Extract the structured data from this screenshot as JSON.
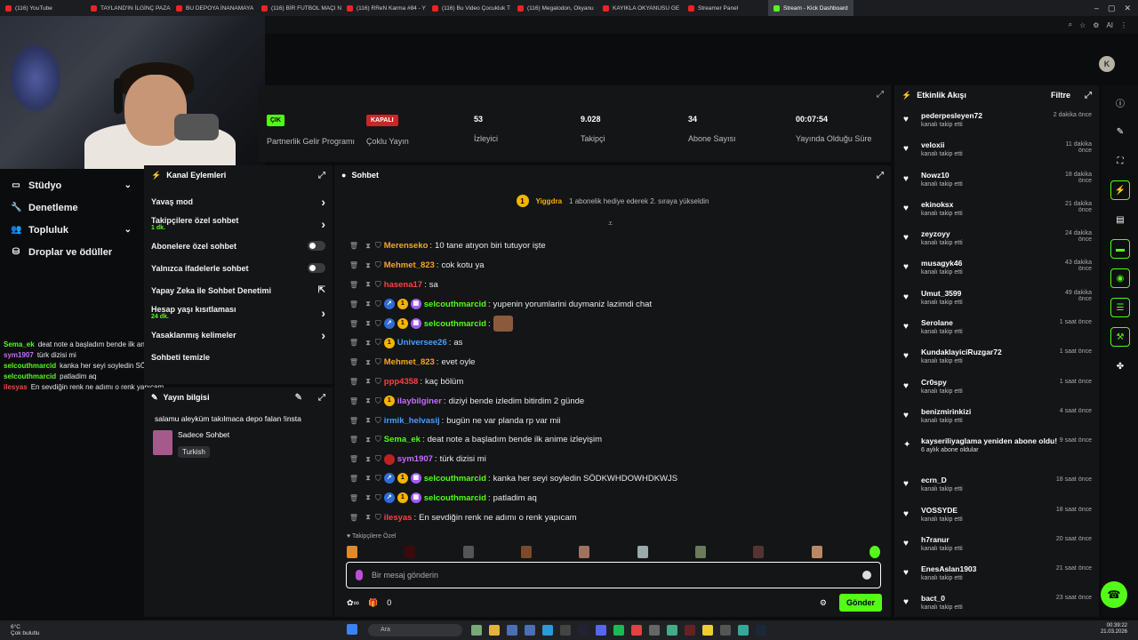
{
  "browser": {
    "tabs": [
      "(116) YouTube",
      "TAYLAND'IN İLGİNÇ PAZA",
      "BU DEPOYA İNANAMAYA",
      "(116) BİR FUTBOL MAÇI N",
      "(116) RReN Karma #84 - Y",
      "(116) Bu Video Çocukluk T",
      "(116) Megalodon, Okyanu",
      "KAYIKLA OKYANUSU GE",
      "Streamer Panel",
      "Stream - Kick Dashboard"
    ],
    "extension_ai": "AI"
  },
  "left_nav": [
    {
      "label": "Stüdyo",
      "icon": "monitor-icon",
      "chevron": true
    },
    {
      "label": "Denetleme",
      "icon": "wrench-icon",
      "chevron": false
    },
    {
      "label": "Topluluk",
      "icon": "people-icon",
      "chevron": true
    },
    {
      "label": "Droplar ve ödüller",
      "icon": "gift-icon",
      "chevron": false
    }
  ],
  "overlay_chat": [
    {
      "user": "Sema_ek",
      "color": "#53fc18",
      "text": "deat note a başladım bende ilk anime izleyişim"
    },
    {
      "user": "sym1907",
      "color": "#c86bff",
      "text": "türk dizisi mi"
    },
    {
      "user": "selcouthmarcid",
      "color": "#53fc18",
      "text": "kanka her seyi soyledin SÖDKWHDOWHDKWJS"
    },
    {
      "user": "selcouthmarcid",
      "color": "#53fc18",
      "text": "patladim aq"
    },
    {
      "user": "ilesyas",
      "color": "#ff4040",
      "text": "En sevdiğin renk ne adımı o renk yapıcam"
    }
  ],
  "stats": [
    {
      "value": "ÇIK",
      "label": "Partnerlik Gelir Programı",
      "kind": "green"
    },
    {
      "value": "KAPALI",
      "label": "Çoklu Yayın",
      "kind": "red"
    },
    {
      "value": "53",
      "label": "İzleyici",
      "kind": "text"
    },
    {
      "value": "9.028",
      "label": "Takipçi",
      "kind": "text"
    },
    {
      "value": "34",
      "label": "Abone Sayısı",
      "kind": "text"
    },
    {
      "value": "00:07:54",
      "label": "Yayında Olduğu Süre",
      "kind": "text"
    }
  ],
  "kanal": {
    "title": "Kanal Eylemleri",
    "rows": [
      {
        "label": "Yavaş mod",
        "sub": "",
        "control": "chevron"
      },
      {
        "label": "Takipçilere özel sohbet",
        "sub": "1 dk.",
        "control": "chevron"
      },
      {
        "label": "Abonelere özel sohbet",
        "sub": "",
        "control": "toggle"
      },
      {
        "label": "Yalnızca ifadelerle sohbet",
        "sub": "",
        "control": "toggle"
      },
      {
        "label": "Yapay Zeka ile Sohbet Denetimi",
        "sub": "",
        "control": "external"
      },
      {
        "label": "Hesap yaşı kısıtlaması",
        "sub": "24 dk.",
        "control": "chevron"
      },
      {
        "label": "Yasaklanmış kelimeler",
        "sub": "",
        "control": "chevron"
      },
      {
        "label": "Sohbeti temizle",
        "sub": "",
        "control": "none"
      }
    ]
  },
  "yayin": {
    "title": "Yayın bilgisi",
    "stream_title": "salamu aleyküm takılmaca depo falan !insta",
    "category": "Sadece Sohbet",
    "language": "Turkish"
  },
  "chat": {
    "title": "Sohbet",
    "pinned_user": "Yiggdra",
    "pinned_count": "1",
    "pinned_text": "1 abonelik hediye ederek 2. sıraya yükseldin",
    "messages": [
      {
        "user": "Merensekо",
        "color": "#f5a623",
        "text": "10 tane atıyon biri tutuyor işte",
        "badges": []
      },
      {
        "user": "Mehmet_823",
        "color": "#f5a623",
        "text": "cok kotu ya",
        "badges": []
      },
      {
        "user": "hasena17",
        "color": "#ff4040",
        "text": "sa",
        "badges": []
      },
      {
        "user": "selcouthmarcid",
        "color": "#53fc18",
        "text": "yupenin yorumlarini duymaniz lazimdi chat",
        "badges": [
          "gift",
          "num",
          "sub"
        ]
      },
      {
        "user": "selcouthmarcid",
        "color": "#53fc18",
        "text": "",
        "badges": [
          "gift",
          "num",
          "sub"
        ],
        "emote": true
      },
      {
        "user": "Universee26",
        "color": "#4a9eff",
        "text": "as",
        "badges": [
          "num"
        ]
      },
      {
        "user": "Mehmet_823",
        "color": "#f5a623",
        "text": "evet oyle",
        "badges": []
      },
      {
        "user": "ppp4358",
        "color": "#ff4040",
        "text": "kaç bölüm",
        "badges": []
      },
      {
        "user": "ilaybilginer",
        "color": "#c86bff",
        "text": "diziyi bende izledim bitirdim 2 günde",
        "badges": [
          "num"
        ]
      },
      {
        "user": "irmik_helvasij",
        "color": "#4a9eff",
        "text": "bugün ne var planda rp var mii",
        "badges": []
      },
      {
        "user": "Sema_ek",
        "color": "#53fc18",
        "text": "deat note a başladım bende ilk anime izleyişim",
        "badges": []
      },
      {
        "user": "sym1907",
        "color": "#c86bff",
        "text": "türk dizisi mi",
        "badges": [
          "red"
        ]
      },
      {
        "user": "selcouthmarcid",
        "color": "#53fc18",
        "text": "kanka her seyi soyledin SÖDKWHDOWHDKWJS",
        "badges": [
          "gift",
          "num",
          "sub"
        ]
      },
      {
        "user": "selcouthmarcid",
        "color": "#53fc18",
        "text": "patladim aq",
        "badges": [
          "gift",
          "num",
          "sub"
        ]
      },
      {
        "user": "ilesyas",
        "color": "#ff4040",
        "text": "En sevdiğin renk ne adımı o renk yapıcam",
        "badges": []
      }
    ],
    "followers_label": "Takipçilere Özel",
    "input_placeholder": "Bir mesaj gönderin",
    "points": "0",
    "send_label": "Gönder"
  },
  "activity": {
    "title": "Etkinlik Akışı",
    "filter_label": "Filtre",
    "items": [
      {
        "name": "pederpesleyen72",
        "desc": "kanalı takip etti",
        "time": "2 dakika önce"
      },
      {
        "name": "veloxii",
        "desc": "kanalı takip etti",
        "time": "11 dakika önce"
      },
      {
        "name": "Nowz10",
        "desc": "kanalı takip etti",
        "time": "18 dakika önce"
      },
      {
        "name": "ekinoksx",
        "desc": "kanalı takip etti",
        "time": "21 dakika önce"
      },
      {
        "name": "zeyzoyy",
        "desc": "kanalı takip etti",
        "time": "24 dakika önce"
      },
      {
        "name": "musagyk46",
        "desc": "kanalı takip etti",
        "time": "43 dakika önce"
      },
      {
        "name": "Umut_3599",
        "desc": "kanalı takip etti",
        "time": "49 dakika önce"
      },
      {
        "name": "Serolane",
        "desc": "kanalı takip etti",
        "time": "1 saat önce"
      },
      {
        "name": "KundaklayiciRuzgar72",
        "desc": "kanalı takip etti",
        "time": "1 saat önce"
      },
      {
        "name": "Cr0spy",
        "desc": "kanalı takip etti",
        "time": "1 saat önce"
      },
      {
        "name": "benizmirinkizi",
        "desc": "kanalı takip etti",
        "time": "4 saat önce"
      },
      {
        "name": "kayseriliyaglama yeniden abone oldu!",
        "desc": "6 aylık abone oldular",
        "time": "9 saat önce"
      },
      {
        "name": "ecrn_D",
        "desc": "kanalı takip etti",
        "time": "18 saat önce"
      },
      {
        "name": "VOSSYDE",
        "desc": "kanalı takip etti",
        "time": "18 saat önce"
      },
      {
        "name": "h7ranur",
        "desc": "kanalı takip etti",
        "time": "20 saat önce"
      },
      {
        "name": "EnesAslan1903",
        "desc": "kanalı takip etti",
        "time": "21 saat önce"
      },
      {
        "name": "bact_0",
        "desc": "kanalı takip etti",
        "time": "23 saat önce"
      }
    ]
  },
  "taskbar": {
    "temp": "6°C",
    "weather": "Çok bulutlu",
    "search": "Ara",
    "time": "00:39:22",
    "date": "21.03.2026"
  }
}
